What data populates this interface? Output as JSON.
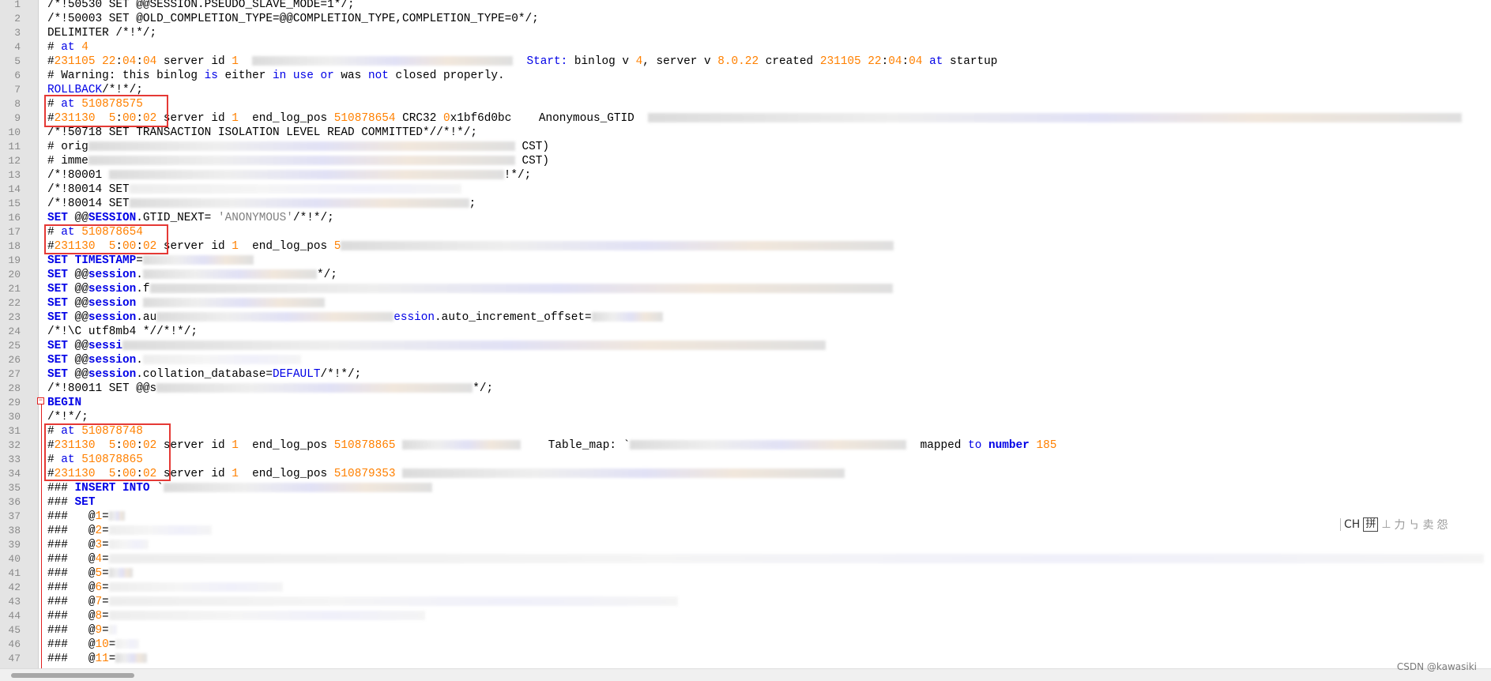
{
  "editor": {
    "lines": [
      {
        "n": "1",
        "segs": [
          {
            "t": "/*!50530 SET @@SESSION.PSEUDO_SLAVE_MODE=1*/;"
          }
        ]
      },
      {
        "n": "2",
        "segs": [
          {
            "t": "/*!50003 SET @OLD_COMPLETION_TYPE=@@COMPLETION_TYPE,COMPLETION_TYPE=0*/;"
          }
        ]
      },
      {
        "n": "3",
        "segs": [
          {
            "t": "DELIMITER /*!*/;"
          }
        ]
      },
      {
        "n": "4",
        "segs": [
          {
            "t": "# "
          },
          {
            "t": "at",
            "c": "k"
          },
          {
            "t": " "
          },
          {
            "t": "4",
            "c": "n"
          }
        ]
      },
      {
        "n": "5",
        "segs": [
          {
            "t": "#"
          },
          {
            "t": "231105",
            "c": "n"
          },
          {
            "t": " "
          },
          {
            "t": "22",
            "c": "n"
          },
          {
            "t": ":"
          },
          {
            "t": "04",
            "c": "n"
          },
          {
            "t": ":"
          },
          {
            "t": "04",
            "c": "n"
          },
          {
            "t": " server id "
          },
          {
            "t": "1",
            "c": "n"
          },
          {
            "t": "  "
          },
          {
            "b": 330
          },
          {
            "t": "  "
          },
          {
            "t": "Start:",
            "c": "k"
          },
          {
            "t": " binlog v "
          },
          {
            "t": "4",
            "c": "n"
          },
          {
            "t": ", server v "
          },
          {
            "t": "8.0.22",
            "c": "n"
          },
          {
            "t": " created "
          },
          {
            "t": "231105",
            "c": "n"
          },
          {
            "t": " "
          },
          {
            "t": "22",
            "c": "n"
          },
          {
            "t": ":"
          },
          {
            "t": "04",
            "c": "n"
          },
          {
            "t": ":"
          },
          {
            "t": "04",
            "c": "n"
          },
          {
            "t": " "
          },
          {
            "t": "at",
            "c": "k"
          },
          {
            "t": " startup"
          }
        ]
      },
      {
        "n": "6",
        "segs": [
          {
            "t": "# Warning: this binlog "
          },
          {
            "t": "is",
            "c": "k"
          },
          {
            "t": " either "
          },
          {
            "t": "in",
            "c": "k"
          },
          {
            "t": " "
          },
          {
            "t": "use",
            "c": "k"
          },
          {
            "t": " "
          },
          {
            "t": "or",
            "c": "k"
          },
          {
            "t": " was "
          },
          {
            "t": "not",
            "c": "k"
          },
          {
            "t": " closed properly."
          }
        ]
      },
      {
        "n": "7",
        "segs": [
          {
            "t": "ROLLBACK",
            "c": "k"
          },
          {
            "t": "/*!*/;"
          }
        ]
      },
      {
        "n": "8",
        "segs": [
          {
            "t": "# "
          },
          {
            "t": "at",
            "c": "k"
          },
          {
            "t": " "
          },
          {
            "t": "510878575",
            "c": "n"
          }
        ]
      },
      {
        "n": "9",
        "segs": [
          {
            "t": "#"
          },
          {
            "t": "231130",
            "c": "n"
          },
          {
            "t": "  "
          },
          {
            "t": "5",
            "c": "n"
          },
          {
            "t": ":"
          },
          {
            "t": "00",
            "c": "n"
          },
          {
            "t": ":"
          },
          {
            "t": "02",
            "c": "n"
          },
          {
            "t": " server id "
          },
          {
            "t": "1",
            "c": "n"
          },
          {
            "t": "  end_log_pos "
          },
          {
            "t": "510878654",
            "c": "n"
          },
          {
            "t": " CRC32 "
          },
          {
            "t": "0",
            "c": "n"
          },
          {
            "t": "x1bf6d0bc    Anonymous_GTID  "
          },
          {
            "b": 1030
          }
        ]
      },
      {
        "n": "10",
        "segs": [
          {
            "t": "/*!50718 SET TRANSACTION ISOLATION LEVEL READ COMMITTED*//*!*/;"
          }
        ]
      },
      {
        "n": "11",
        "segs": [
          {
            "t": "# orig"
          },
          {
            "b": 540
          },
          {
            "t": " CST)"
          }
        ]
      },
      {
        "n": "12",
        "segs": [
          {
            "t": "# imme"
          },
          {
            "b": 540
          },
          {
            "t": " CST)"
          }
        ]
      },
      {
        "n": "13",
        "segs": [
          {
            "t": "/*!80001 "
          },
          {
            "b": 500
          },
          {
            "t": "!*/;"
          }
        ]
      },
      {
        "n": "14",
        "segs": [
          {
            "t": "/*!80014 SET"
          },
          {
            "b": 420,
            "l": 1
          }
        ]
      },
      {
        "n": "15",
        "segs": [
          {
            "t": "/*!80014 SET"
          },
          {
            "b": 430
          },
          {
            "t": ";"
          }
        ]
      },
      {
        "n": "16",
        "segs": [
          {
            "t": "SET",
            "c": "kb"
          },
          {
            "t": " @@"
          },
          {
            "t": "SESSION",
            "c": "kb"
          },
          {
            "t": ".GTID_NEXT= "
          },
          {
            "t": "'ANONYMOUS'",
            "c": "s"
          },
          {
            "t": "/*!*/;"
          }
        ]
      },
      {
        "n": "17",
        "segs": [
          {
            "t": "# "
          },
          {
            "t": "at",
            "c": "k"
          },
          {
            "t": " "
          },
          {
            "t": "510878654",
            "c": "n"
          }
        ]
      },
      {
        "n": "18",
        "segs": [
          {
            "t": "#"
          },
          {
            "t": "231130",
            "c": "n"
          },
          {
            "t": "  "
          },
          {
            "t": "5",
            "c": "n"
          },
          {
            "t": ":"
          },
          {
            "t": "00",
            "c": "n"
          },
          {
            "t": ":"
          },
          {
            "t": "02",
            "c": "n"
          },
          {
            "t": " server id "
          },
          {
            "t": "1",
            "c": "n"
          },
          {
            "t": "  end_log_pos "
          },
          {
            "t": "5",
            "c": "n"
          },
          {
            "b": 700
          }
        ]
      },
      {
        "n": "19",
        "segs": [
          {
            "t": "SET",
            "c": "kb"
          },
          {
            "t": " "
          },
          {
            "t": "TIMESTAMP",
            "c": "kb"
          },
          {
            "t": "="
          },
          {
            "b": 140
          }
        ]
      },
      {
        "n": "20",
        "segs": [
          {
            "t": "SET",
            "c": "kb"
          },
          {
            "t": " @@"
          },
          {
            "t": "session",
            "c": "kb"
          },
          {
            "t": "."
          },
          {
            "b": 220
          },
          {
            "t": "*/;"
          }
        ]
      },
      {
        "n": "21",
        "segs": [
          {
            "t": "SET",
            "c": "kb"
          },
          {
            "t": " @@"
          },
          {
            "t": "session",
            "c": "kb"
          },
          {
            "t": ".f"
          },
          {
            "b": 940
          }
        ]
      },
      {
        "n": "22",
        "segs": [
          {
            "t": "SET",
            "c": "kb"
          },
          {
            "t": " @@"
          },
          {
            "t": "session",
            "c": "kb"
          },
          {
            "t": " "
          },
          {
            "b": 230
          }
        ]
      },
      {
        "n": "23",
        "segs": [
          {
            "t": "SET",
            "c": "kb"
          },
          {
            "t": " @@"
          },
          {
            "t": "session",
            "c": "kb"
          },
          {
            "t": ".au"
          },
          {
            "b": 300
          },
          {
            "t": "ession",
            "c": "k"
          },
          {
            "t": ".auto_increment_offset="
          },
          {
            "b": 90
          }
        ]
      },
      {
        "n": "24",
        "segs": [
          {
            "t": "/*!\\C utf8mb4 *//*!*/;"
          }
        ]
      },
      {
        "n": "25",
        "segs": [
          {
            "t": "SET",
            "c": "kb"
          },
          {
            "t": " @@"
          },
          {
            "t": "sessi",
            "c": "kb"
          },
          {
            "b": 890
          }
        ]
      },
      {
        "n": "26",
        "segs": [
          {
            "t": "SET",
            "c": "kb"
          },
          {
            "t": " @@"
          },
          {
            "t": "session",
            "c": "kb"
          },
          {
            "t": "."
          },
          {
            "b": 200,
            "l": 1
          }
        ]
      },
      {
        "n": "27",
        "segs": [
          {
            "t": "SET",
            "c": "kb"
          },
          {
            "t": " @@"
          },
          {
            "t": "session",
            "c": "kb"
          },
          {
            "t": ".collation_database="
          },
          {
            "t": "DEFAULT",
            "c": "k"
          },
          {
            "t": "/*!*/;"
          }
        ]
      },
      {
        "n": "28",
        "segs": [
          {
            "t": "/*!80011 SET @@s"
          },
          {
            "b": 400
          },
          {
            "t": "*/;"
          }
        ]
      },
      {
        "n": "29",
        "segs": [
          {
            "t": "BEGIN",
            "c": "kb"
          }
        ]
      },
      {
        "n": "30",
        "segs": [
          {
            "t": "/*!*/;"
          }
        ]
      },
      {
        "n": "31",
        "segs": [
          {
            "t": "# "
          },
          {
            "t": "at",
            "c": "k"
          },
          {
            "t": " "
          },
          {
            "t": "510878748",
            "c": "n"
          }
        ]
      },
      {
        "n": "32",
        "segs": [
          {
            "t": "#"
          },
          {
            "t": "231130",
            "c": "n"
          },
          {
            "t": "  "
          },
          {
            "t": "5",
            "c": "n"
          },
          {
            "t": ":"
          },
          {
            "t": "00",
            "c": "n"
          },
          {
            "t": ":"
          },
          {
            "t": "02",
            "c": "n"
          },
          {
            "t": " server id "
          },
          {
            "t": "1",
            "c": "n"
          },
          {
            "t": "  end_log_pos "
          },
          {
            "t": "510878865",
            "c": "n"
          },
          {
            "t": " "
          },
          {
            "b": 150
          },
          {
            "t": "    Table_map: `"
          },
          {
            "b": 350
          },
          {
            "t": "  mapped "
          },
          {
            "t": "to",
            "c": "k"
          },
          {
            "t": " "
          },
          {
            "t": "number",
            "c": "kb"
          },
          {
            "t": " "
          },
          {
            "t": "185",
            "c": "n"
          }
        ]
      },
      {
        "n": "33",
        "segs": [
          {
            "t": "# "
          },
          {
            "t": "at",
            "c": "k"
          },
          {
            "t": " "
          },
          {
            "t": "510878865",
            "c": "n"
          }
        ]
      },
      {
        "n": "34",
        "segs": [
          {
            "t": "#"
          },
          {
            "t": "231130",
            "c": "n"
          },
          {
            "t": "  "
          },
          {
            "t": "5",
            "c": "n"
          },
          {
            "t": ":"
          },
          {
            "t": "00",
            "c": "n"
          },
          {
            "t": ":"
          },
          {
            "t": "02",
            "c": "n"
          },
          {
            "t": " server id "
          },
          {
            "t": "1",
            "c": "n"
          },
          {
            "t": "  end_log_pos "
          },
          {
            "t": "510879353",
            "c": "n"
          },
          {
            "t": " "
          },
          {
            "b": 560
          }
        ]
      },
      {
        "n": "35",
        "segs": [
          {
            "t": "### "
          },
          {
            "t": "INSERT",
            "c": "kb"
          },
          {
            "t": " "
          },
          {
            "t": "INTO",
            "c": "kb"
          },
          {
            "t": " `"
          },
          {
            "b": 340
          }
        ]
      },
      {
        "n": "36",
        "segs": [
          {
            "t": "### "
          },
          {
            "t": "SET",
            "c": "kb"
          }
        ]
      },
      {
        "n": "37",
        "segs": [
          {
            "t": "###   @"
          },
          {
            "t": "1",
            "c": "n"
          },
          {
            "t": "="
          },
          {
            "b": 20
          }
        ]
      },
      {
        "n": "38",
        "segs": [
          {
            "t": "###   @"
          },
          {
            "t": "2",
            "c": "n"
          },
          {
            "t": "="
          },
          {
            "b": 130,
            "l": 1
          }
        ]
      },
      {
        "n": "39",
        "segs": [
          {
            "t": "###   @"
          },
          {
            "t": "3",
            "c": "n"
          },
          {
            "t": "="
          },
          {
            "b": 50,
            "l": 1
          }
        ]
      },
      {
        "n": "40",
        "segs": [
          {
            "t": "###   @"
          },
          {
            "t": "4",
            "c": "n"
          },
          {
            "t": "="
          },
          {
            "b": 1740,
            "l": 1
          }
        ]
      },
      {
        "n": "41",
        "segs": [
          {
            "t": "###   @"
          },
          {
            "t": "5",
            "c": "n"
          },
          {
            "t": "="
          },
          {
            "b": 30
          }
        ]
      },
      {
        "n": "42",
        "segs": [
          {
            "t": "###   @"
          },
          {
            "t": "6",
            "c": "n"
          },
          {
            "t": "="
          },
          {
            "b": 220,
            "l": 1
          }
        ]
      },
      {
        "n": "43",
        "segs": [
          {
            "t": "###   @"
          },
          {
            "t": "7",
            "c": "n"
          },
          {
            "t": "="
          },
          {
            "b": 720,
            "l": 1
          }
        ]
      },
      {
        "n": "44",
        "segs": [
          {
            "t": "###   @"
          },
          {
            "t": "8",
            "c": "n"
          },
          {
            "t": "="
          },
          {
            "b": 400,
            "l": 1
          }
        ]
      },
      {
        "n": "45",
        "segs": [
          {
            "t": "###   @"
          },
          {
            "t": "9",
            "c": "n"
          },
          {
            "t": "="
          },
          {
            "b": 10,
            "l": 1
          }
        ]
      },
      {
        "n": "46",
        "segs": [
          {
            "t": "###   @"
          },
          {
            "t": "10",
            "c": "n"
          },
          {
            "t": "="
          },
          {
            "b": 30,
            "l": 1
          }
        ]
      },
      {
        "n": "47",
        "segs": [
          {
            "t": "###   @"
          },
          {
            "t": "11",
            "c": "n"
          },
          {
            "t": "="
          },
          {
            "b": 40
          }
        ]
      }
    ]
  },
  "ime_toolbar": {
    "mode": "CH",
    "pinyin": "拼",
    "items": [
      "⊥",
      "力",
      "㇉",
      "卖",
      "怨"
    ]
  },
  "watermark": "CSDN @kawasiki"
}
